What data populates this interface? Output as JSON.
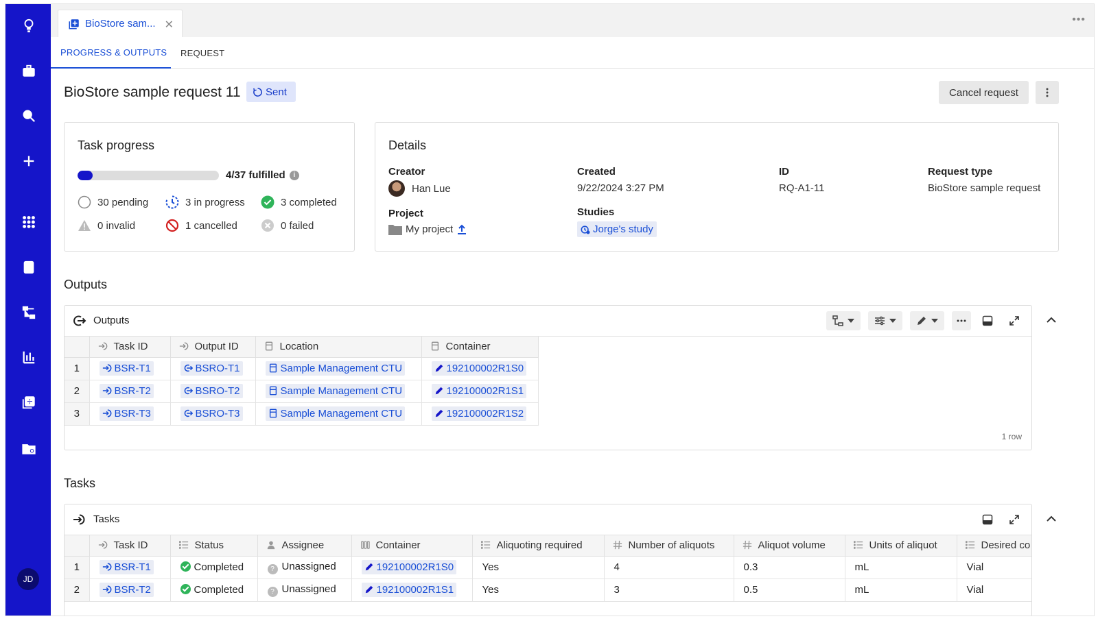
{
  "nav": {
    "items": [
      "logo-icon",
      "briefcase-icon",
      "search-icon",
      "plus-icon",
      "apps-grid-icon",
      "inventory-icon",
      "workflow-icon",
      "chart-icon",
      "requests-icon",
      "folder-settings-icon"
    ],
    "user_initials": "JD"
  },
  "tab": {
    "label": "BioStore sam..."
  },
  "subtabs": {
    "active": "PROGRESS & OUTPUTS",
    "inactive": "REQUEST"
  },
  "page": {
    "title": "BioStore sample request 11",
    "status": "Sent",
    "cancel_label": "Cancel request"
  },
  "task_progress": {
    "title": "Task progress",
    "fulfilled_count": 4,
    "total": 37,
    "fulfilled_label": "4/37 fulfilled",
    "stats": {
      "pending": "30 pending",
      "in_progress": "3 in progress",
      "completed": "3 completed",
      "invalid": "0 invalid",
      "cancelled": "1 cancelled",
      "failed": "0 failed"
    }
  },
  "details": {
    "title": "Details",
    "creator_label": "Creator",
    "creator": "Han Lue",
    "created_label": "Created",
    "created": "9/22/2024 3:27 PM",
    "id_label": "ID",
    "id": "RQ-A1-11",
    "type_label": "Request type",
    "type": "BioStore sample request",
    "project_label": "Project",
    "project": "My project",
    "studies_label": "Studies",
    "study": "Jorge's study"
  },
  "outputs": {
    "section_title": "Outputs",
    "panel_title": "Outputs",
    "columns": [
      "Task ID",
      "Output ID",
      "Location",
      "Container"
    ],
    "rows": [
      {
        "n": "1",
        "task": "BSR-T1",
        "output": "BSRO-T1",
        "location": "Sample Management CTU",
        "container": "192100002R1S0"
      },
      {
        "n": "2",
        "task": "BSR-T2",
        "output": "BSRO-T2",
        "location": "Sample Management CTU",
        "container": "192100002R1S1"
      },
      {
        "n": "3",
        "task": "BSR-T3",
        "output": "BSRO-T3",
        "location": "Sample Management CTU",
        "container": "192100002R1S2"
      }
    ],
    "row_count": "1 row"
  },
  "tasks": {
    "section_title": "Tasks",
    "panel_title": "Tasks",
    "columns": [
      "Task ID",
      "Status",
      "Assignee",
      "Container",
      "Aliquoting required",
      "Number of aliquots",
      "Aliquot volume",
      "Units of aliquot",
      "Desired co"
    ],
    "rows": [
      {
        "n": "1",
        "task": "BSR-T1",
        "status": "Completed",
        "assignee": "Unassigned",
        "container": "192100002R1S0",
        "aliquoting": "Yes",
        "num": "4",
        "volume": "0.3",
        "units": "mL",
        "desired": "Vial"
      },
      {
        "n": "2",
        "task": "BSR-T2",
        "status": "Completed",
        "assignee": "Unassigned",
        "container": "192100002R1S1",
        "aliquoting": "Yes",
        "num": "3",
        "volume": "0.5",
        "units": "mL",
        "desired": "Vial"
      }
    ]
  },
  "colors": {
    "nav": "#1515c9",
    "link": "#1a4fd6",
    "badge_bg": "#dfe5fb",
    "complete": "#2fb45a",
    "cancel_red": "#d32020"
  }
}
